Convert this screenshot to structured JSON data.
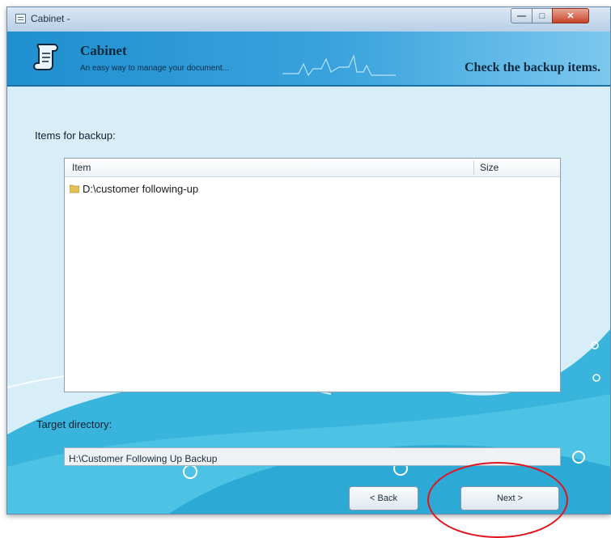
{
  "window": {
    "title": "Cabinet -",
    "controls": [
      "minimize",
      "maximize",
      "close"
    ]
  },
  "banner": {
    "app_name": "Cabinet",
    "subtitle": "An easy way to manage your document...",
    "step_title": "Check the backup items."
  },
  "backup": {
    "items_label": "Items for backup:",
    "columns": {
      "item": "Item",
      "size": "Size"
    },
    "rows": [
      {
        "name": "D:\\customer following-up",
        "size": ""
      }
    ]
  },
  "target": {
    "label": "Target directory:",
    "value": "H:\\Customer Following Up Backup"
  },
  "buttons": {
    "back": "< Back",
    "next": "Next >"
  },
  "colors": {
    "banner": "#2b97d4",
    "content_bg": "#d7eef9",
    "wave": "#3bb5dd",
    "highlight": "#e0141e"
  }
}
